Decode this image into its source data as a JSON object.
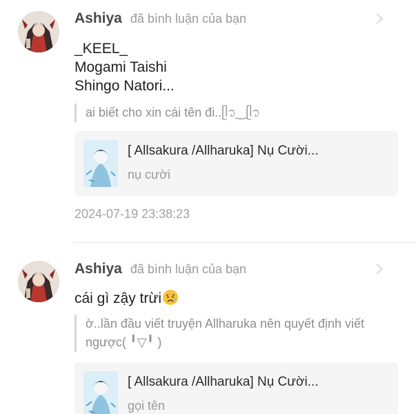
{
  "comments": [
    {
      "username": "Ashiya",
      "action": "đã bình luận của bạn",
      "body_lines": [
        "_KEEL_",
        "Mogami Taishi",
        "Shingo Natori..."
      ],
      "quote": "ai biết cho xin cái tên đi..ᥫ᭡‿ᥫ᭡",
      "card": {
        "title": "[ Allsakura /Allharuka] Nụ Cười...",
        "subtitle": "nụ cười"
      },
      "timestamp": "2024-07-19 23:38:23"
    },
    {
      "username": "Ashiya",
      "action": "đã bình luận của bạn",
      "body_text": "cái gì zậy trừi",
      "body_emoji": "anxious-face-emoji",
      "quote_lines": [
        "ờ..lần đầu viết truyện Allharuka nên quyết định viết",
        "ngược( ╹▽╹ )"
      ],
      "card": {
        "title": "[ Allsakura /Allharuka] Nụ Cười...",
        "subtitle": "gọi tên"
      }
    }
  ],
  "icons": {
    "chevron": "chevron-right-icon"
  },
  "colors": {
    "username": "#4a4a4a",
    "meta": "#9b9b9b",
    "card_bg": "#f5f5f5",
    "quote_bar": "#d6d6d6"
  }
}
